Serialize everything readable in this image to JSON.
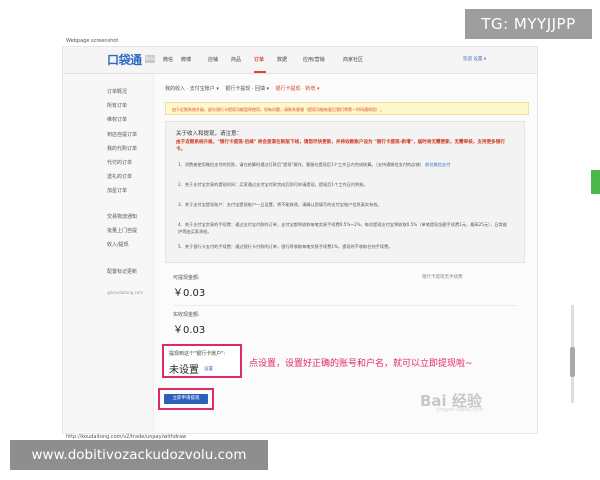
{
  "overlay": {
    "tg_badge": "TG: MYYJJPP",
    "capture_caption": "Webpage screenshot",
    "status_url": "http://koudaitong.com/v2/trade/unpay/withdraw",
    "site_badge": "www.dobitivozackudozvolu.com",
    "annotation": "点设置，设置好正确的账号和户名，就可以立即提现啦~",
    "watermark_main": "Bai 经验",
    "watermark_sub": "jingyan.baidu.com"
  },
  "header": {
    "logo": "口袋通",
    "logo_badge": "Beta",
    "nav": [
      "微信",
      "微博",
      "店铺",
      "商品",
      "订单",
      "数据",
      "应用/营销",
      "商家社区"
    ],
    "active_nav": "订单",
    "top_right": "欢迎   设置 ▾"
  },
  "sidebar": {
    "items": [
      "订单概况",
      "所有订单",
      "维权订单",
      "到店自提订单",
      "我的代购订单",
      "代付的订单",
      "送礼的订单",
      "加星订单",
      "交易物流通知",
      "批量上门自提",
      "收入/提现",
      "配置标记更新",
      "@koudaitong.com"
    ]
  },
  "breadcrumb": {
    "items": [
      "我的收入 · 支付宝账户 ▾",
      "银行卡提现 · 回填 ▾",
      "银行卡提现 · 新增 ▾"
    ],
    "active_index": 2
  },
  "notice": "由于近期系统升级，部分银行卡提现功能暂停使用，如有问题，请联系客服（提现功能恢复后我们将第一时间通知您）。",
  "info": {
    "title": "关于收入和提现，请注意：",
    "warning": "由于近期系统升级，\"银行卡提现-后续\" 将会逐渐在新版下线，请您尽快更新，并将收款账户设为 \"银行卡提现-新增\"，届时将无需更新，无需审核，支持更多银行卡。",
    "steps": [
      {
        "text": "1、消费者使用微信支付的货款，请在结算时通过打款后\"提现\"操作，客服在提现后1个工作日内完成结算。（支持通微信支付的店铺）",
        "link": "前往微信支付"
      },
      {
        "text": "2、关于支付宝交易的提现时间：买家通过支付宝付款完成后即可申请提现，提现后1个工作日内到账。",
        "link": ""
      },
      {
        "text": "3、关于支付宝提现账户：支付宝提现账户一旦设置，将不能修改，请确认您填写的支付宝账户信息真实有效。",
        "link": ""
      },
      {
        "text": "4、关于支付宝交易的手续费：通过支付宝付款的订单，支付宝都将收取每笔交易手续费0.5%~2%，每次提现支付宝将收取0.5%（单笔提现金额手续费1元，最高25元），日常维护等由买家承担。",
        "link": ""
      },
      {
        "text": "5、关于银行卡支付的手续费：通过银行卡付款的订单，银行将收取每笔交易手续费1%，提现时不收取任何手续费。",
        "link": ""
      }
    ]
  },
  "amounts": {
    "withdrawable_label": "可提现金额:",
    "withdrawable_value": "￥0.03",
    "actual_label": "实收现金额:",
    "actual_value": "￥0.03",
    "note": "银行卡提现无手续费"
  },
  "account": {
    "label": "提现到这个\"银行卡账户\":",
    "value": "未设置",
    "set_link": "设置"
  },
  "submit_label": "立即申请提现"
}
